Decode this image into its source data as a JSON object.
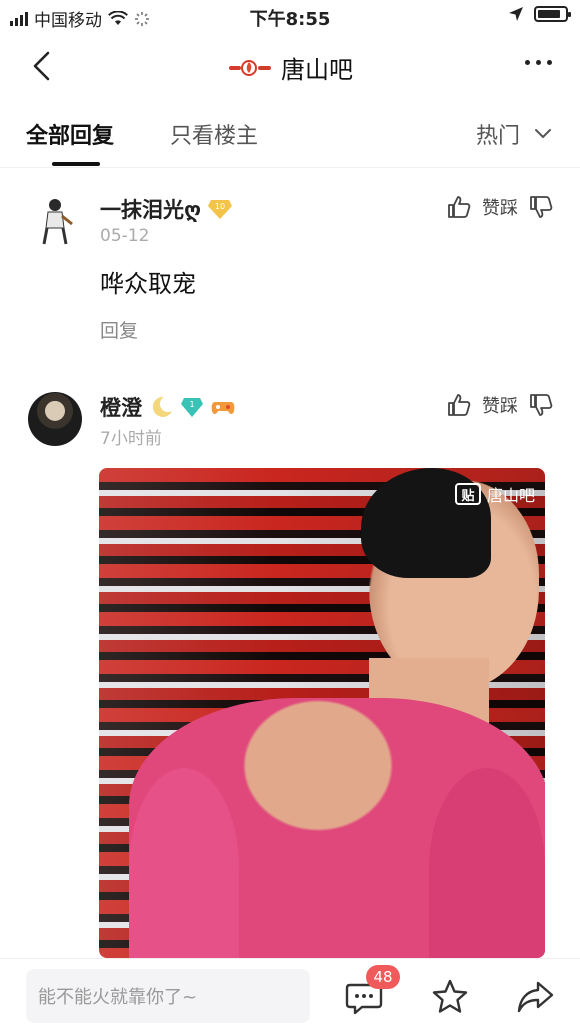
{
  "status_bar": {
    "carrier": "中国移动",
    "time": "下午8:55",
    "battery_level": 0.85,
    "icons": [
      "signal-icon",
      "wifi-icon",
      "loading-icon",
      "location-arrow-icon",
      "battery-icon"
    ]
  },
  "nav": {
    "title": "唐山吧",
    "logo_icon": "bar-logo-icon",
    "back_icon": "chevron-left-icon",
    "more_icon": "more-dots-icon"
  },
  "tabs": {
    "all": "全部回复",
    "op_only": "只看楼主",
    "sort": "热门"
  },
  "comments": [
    {
      "username": "一抹泪光ღ",
      "level": "10",
      "timestamp": "05-12",
      "text": "哗众取宠",
      "reply_label": "回复",
      "vote_label": "赞踩"
    },
    {
      "username": "橙澄",
      "level": "1",
      "timestamp": "7小时前",
      "vote_label": "赞踩",
      "image": {
        "watermark": "唐山吧",
        "watermark_icon": "贴"
      }
    }
  ],
  "bottom_bar": {
    "input_placeholder": "能不能火就靠你了~",
    "comment_count": "48",
    "icons": [
      "comment-icon",
      "star-icon",
      "share-icon"
    ]
  },
  "colors": {
    "badge_red": "#f05a5a",
    "level_gold": "#f3c34a",
    "level_teal": "#39c3b6"
  }
}
